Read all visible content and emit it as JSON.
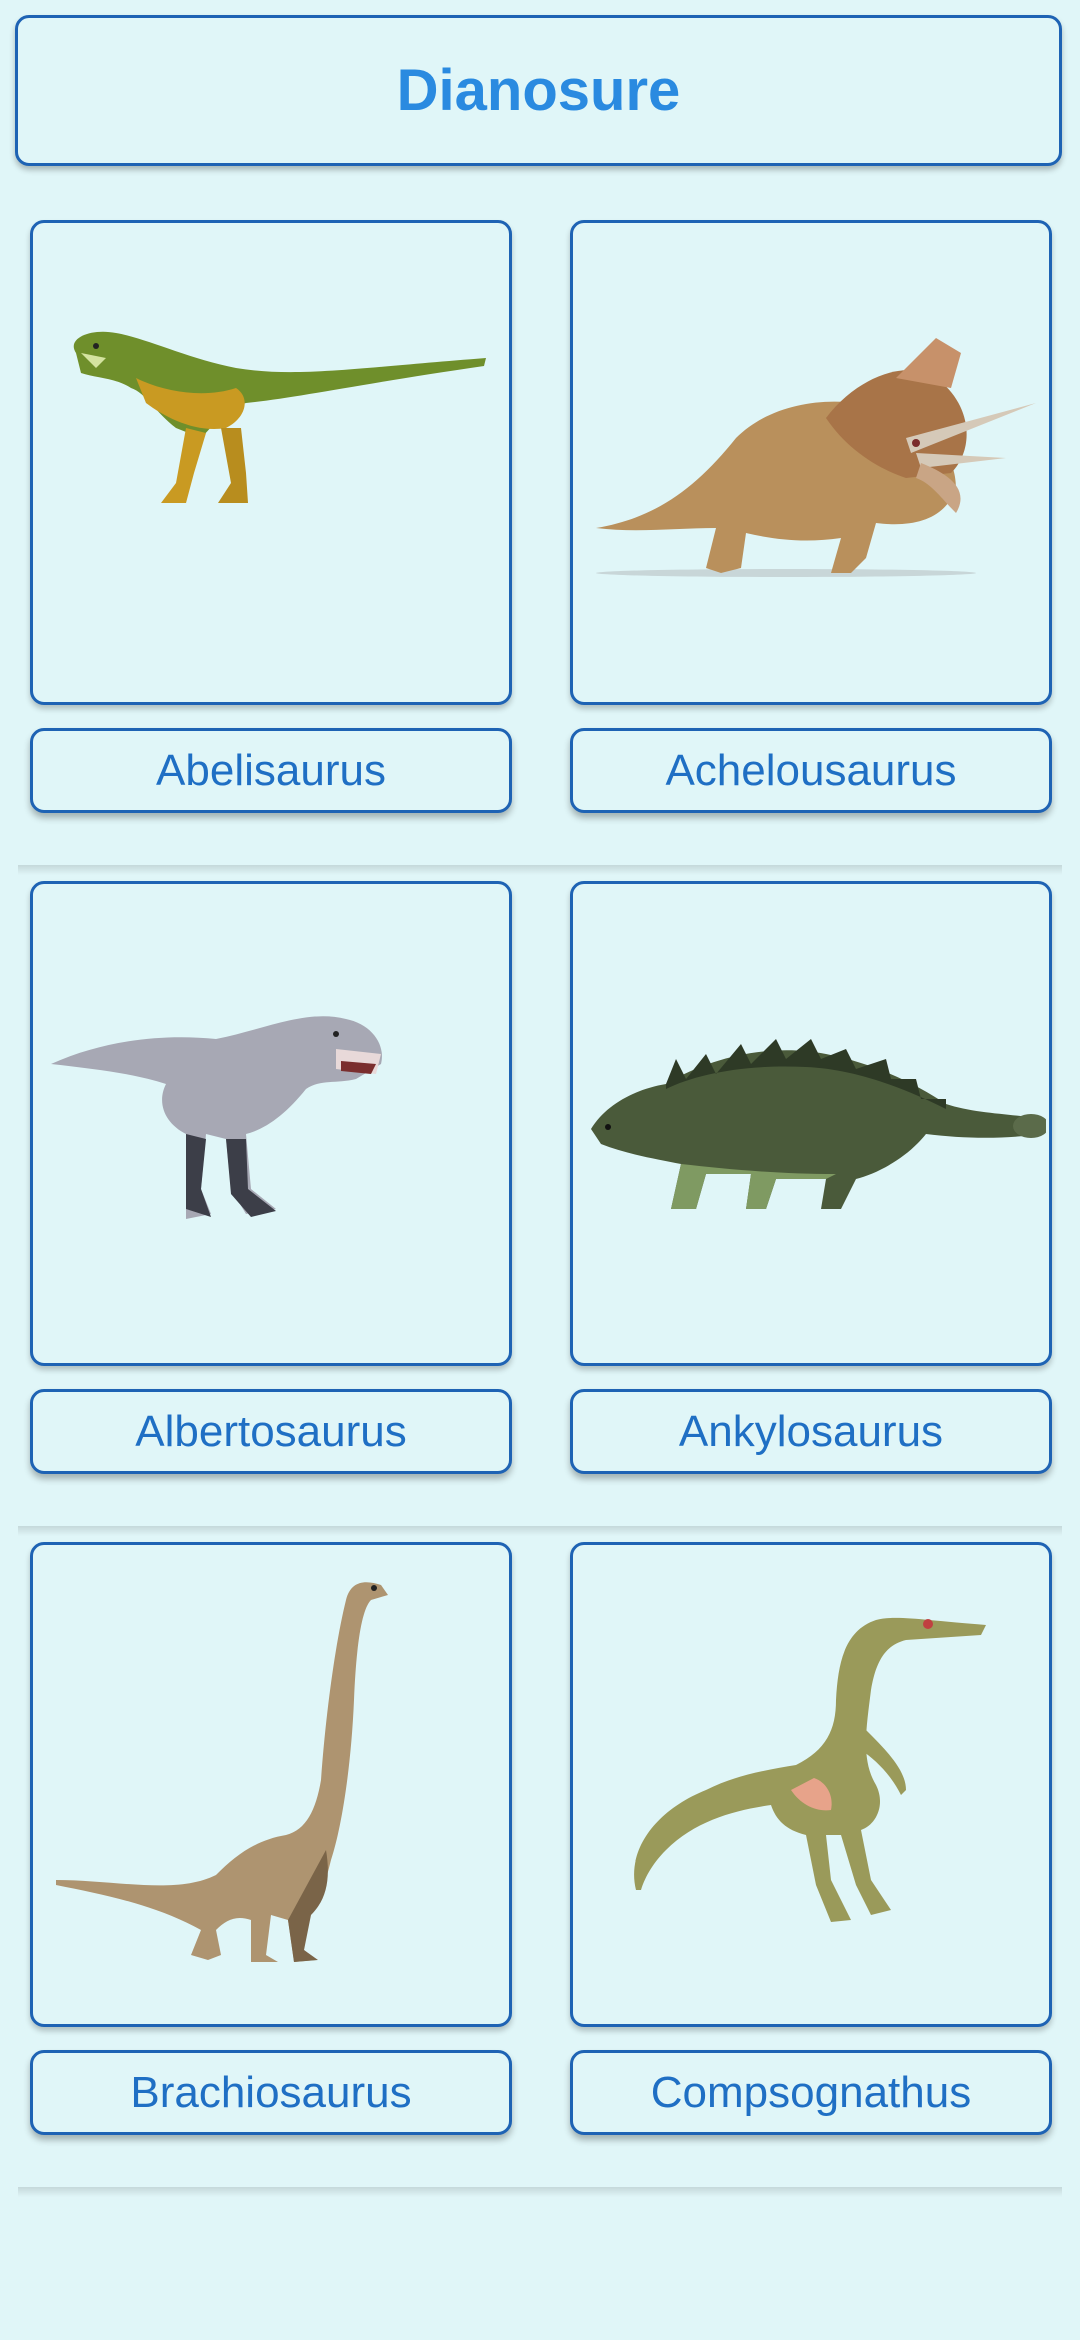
{
  "header": {
    "title": "Dianosure"
  },
  "dinosaurs": [
    {
      "name": "Abelisaurus",
      "icon": "abelisaurus-image"
    },
    {
      "name": "Achelousaurus",
      "icon": "achelousaurus-image"
    },
    {
      "name": "Albertosaurus",
      "icon": "albertosaurus-image"
    },
    {
      "name": "Ankylosaurus",
      "icon": "ankylosaurus-image"
    },
    {
      "name": "Brachiosaurus",
      "icon": "brachiosaurus-image"
    },
    {
      "name": "Compsognathus",
      "icon": "compsognathus-image"
    }
  ]
}
